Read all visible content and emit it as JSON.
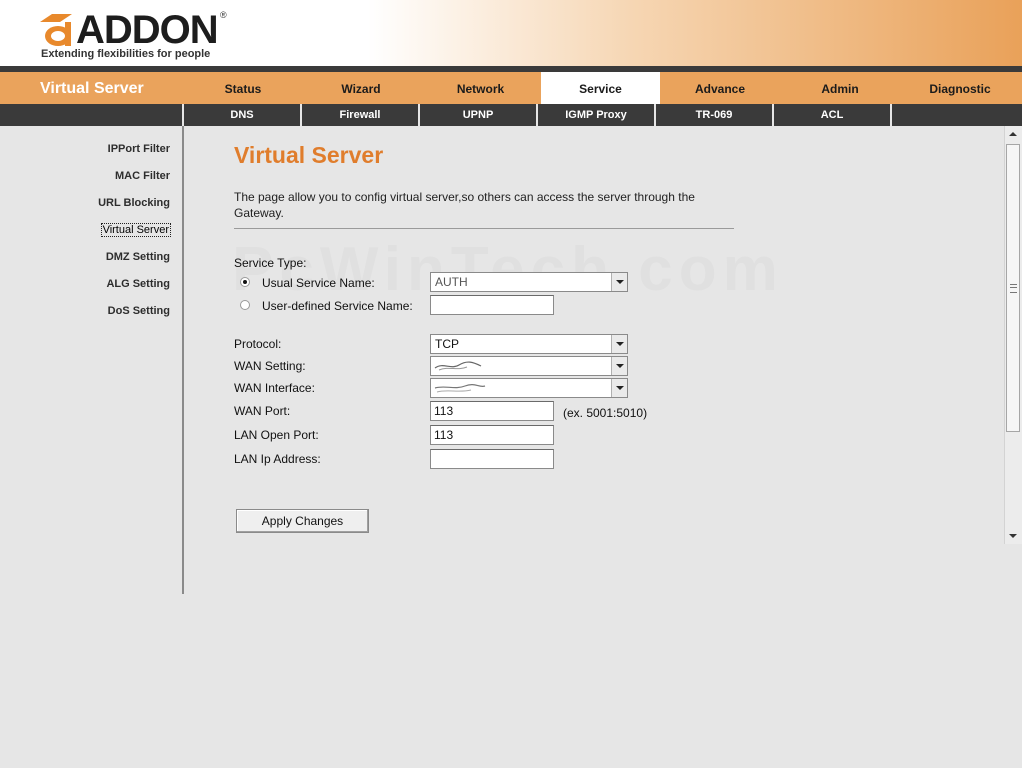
{
  "brand": {
    "logo_text": "ADDON",
    "registered": "®",
    "tagline": "Extending flexibilities for people"
  },
  "nav": {
    "page_name": "Virtual Server",
    "tabs": [
      "Status",
      "Wizard",
      "Network",
      "Service",
      "Advance",
      "Admin",
      "Diagnostic"
    ],
    "active_tab": "Service"
  },
  "subnav": {
    "tabs": [
      "DNS",
      "Firewall",
      "UPNP",
      "IGMP Proxy",
      "TR-069",
      "ACL"
    ]
  },
  "sidebar": {
    "items": [
      "IPPort Filter",
      "MAC Filter",
      "URL Blocking",
      "Virtual Server",
      "DMZ Setting",
      "ALG Setting",
      "DoS Setting"
    ],
    "active": "Virtual Server"
  },
  "main": {
    "title": "Virtual Server",
    "description": "The page allow you to config virtual server,so others can access the server through the Gateway.",
    "watermark": "PcWinTech.com",
    "service_type_label": "Service Type:",
    "usual_service_label": "Usual Service Name:",
    "usual_service_value": "AUTH",
    "user_defined_label": "User-defined Service Name:",
    "user_defined_value": "",
    "protocol_label": "Protocol:",
    "protocol_value": "TCP",
    "wan_setting_label": "WAN Setting:",
    "wan_interface_label": "WAN Interface:",
    "wan_port_label": "WAN Port:",
    "wan_port_value": "113",
    "wan_port_hint": "(ex. 5001:5010)",
    "lan_open_port_label": "LAN Open Port:",
    "lan_open_port_value": "113",
    "lan_ip_label": "LAN Ip Address:",
    "lan_ip_value": "",
    "apply_label": "Apply Changes"
  },
  "colors": {
    "accent_orange": "#eaa35c",
    "title_orange": "#e07d2c",
    "dark_bar": "#3a3a3a",
    "background": "#e6e6e6"
  }
}
